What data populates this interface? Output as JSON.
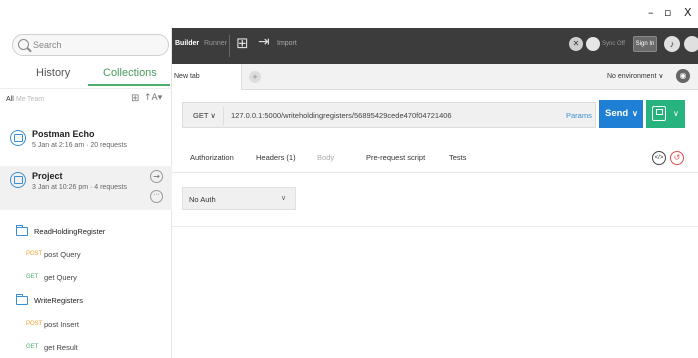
{
  "window": {
    "minimize": "–",
    "maximize": "▫",
    "close": "X"
  },
  "sidebar": {
    "search_placeholder": "Search",
    "tabs": {
      "history": "History",
      "collections": "Collections"
    },
    "filters": {
      "all": "All",
      "me": "Me",
      "team": "Team"
    },
    "collections": [
      {
        "name": "Postman Echo",
        "meta": "5 Jan at 2:16 am  ·  20 requests"
      },
      {
        "name": "Project",
        "meta": "3 Jan at 10:26 pm  ·  4 requests"
      }
    ],
    "folders": [
      {
        "name": "ReadHoldingRegister",
        "requests": [
          {
            "method": "POST",
            "label": "post Query"
          },
          {
            "method": "GET",
            "label": "get Query"
          }
        ]
      },
      {
        "name": "WriteRegisters",
        "requests": [
          {
            "method": "POST",
            "label": "post Insert"
          },
          {
            "method": "GET",
            "label": "get Result"
          }
        ]
      }
    ]
  },
  "toolbar": {
    "builder": "Builder",
    "runner": "Runner",
    "import": "Import",
    "sync": "Sync Off",
    "signin": "Sign In"
  },
  "tabstrip": {
    "active_tab": "New tab",
    "environment": "No environment ∨"
  },
  "request": {
    "method": "GET ∨",
    "url": "127.0.0.1:5000/writeholdingregisters/56895429cede470f04721406",
    "params": "Params",
    "send": "Send",
    "caret": "∨"
  },
  "subtabs": {
    "authorization": "Authorization",
    "headers": "Headers (1)",
    "body": "Body",
    "prerequest": "Pre-request script",
    "tests": "Tests"
  },
  "auth": {
    "value": "No Auth",
    "caret": "∨"
  },
  "colors": {
    "toolbar_bg": "#3c3c3c",
    "send_blue": "#1f7fd4",
    "save_green": "#26b37d",
    "collections_green": "#4caf6e",
    "post_orange": "#f0a030",
    "get_green": "#4caf6e"
  }
}
